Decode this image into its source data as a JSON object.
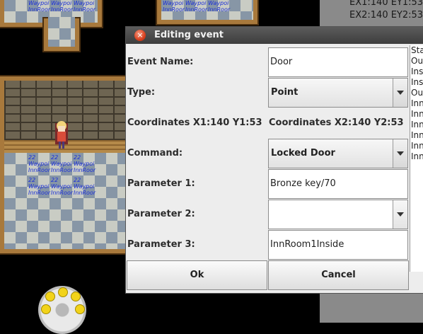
{
  "map": {
    "status_line_1": "EX1:140 EY1:53",
    "status_line_2": "EX2:140 EY2:53",
    "waypoint_number": "22",
    "waypoint_label": "Waypoi",
    "waypoint_room": "InnRoor"
  },
  "dialog": {
    "title": "Editing event",
    "event_name_label": "Event Name:",
    "event_name_value": "Door",
    "type_label": "Type:",
    "type_value": "Point",
    "coords_1": "Coordinates X1:140 Y1:53",
    "coords_2": "Coordinates X2:140 Y2:53",
    "command_label": "Command:",
    "command_value": "Locked Door",
    "param1_label": "Parameter 1:",
    "param1_value": "Bronze key/70",
    "param2_label": "Parameter 2:",
    "param2_value": "",
    "param3_label": "Parameter 3:",
    "param3_value": "InnRoom1Inside",
    "ok_label": "Ok",
    "cancel_label": "Cancel"
  },
  "side_list": {
    "items": [
      "Sta",
      "Out",
      "Ins",
      "Ins",
      "Out",
      "Inn",
      "Inn",
      "Inn",
      "Inn",
      "Inn",
      "Inn"
    ]
  },
  "colors": {
    "titlebar": "#4a4a4a",
    "close_button": "#d9401f",
    "dialog_bg": "#ededed"
  }
}
